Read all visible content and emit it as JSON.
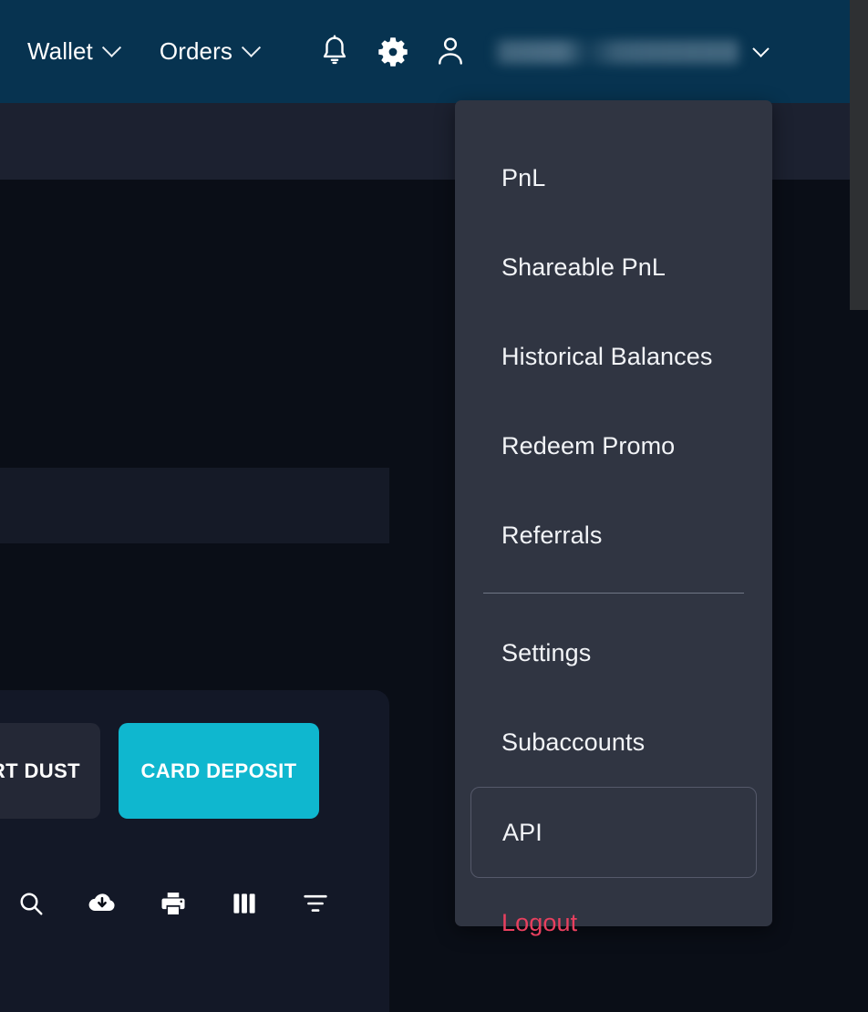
{
  "topbar": {
    "background_color": "#073350",
    "nav_items": [
      {
        "label": "Wallet",
        "icon": "chevron-down-icon"
      },
      {
        "label": "Orders",
        "icon": "chevron-down-icon"
      }
    ],
    "icons": [
      {
        "name": "notifications-bell-icon"
      },
      {
        "name": "settings-gear-icon"
      },
      {
        "name": "account-person-icon"
      }
    ],
    "user": {
      "display_name": "",
      "redacted": "blurred",
      "chevron": "chevron-down-icon"
    }
  },
  "account_menu": {
    "background_color": "#303542",
    "items": [
      {
        "label": "PnL",
        "state": "normal"
      },
      {
        "label": "Shareable PnL",
        "state": "normal"
      },
      {
        "label": "Historical Balances",
        "state": "normal"
      },
      {
        "label": "Redeem Promo",
        "state": "normal"
      },
      {
        "label": "Referrals",
        "state": "normal"
      },
      {
        "label": "Settings",
        "state": "normal"
      },
      {
        "label": "Subaccounts",
        "state": "normal"
      },
      {
        "label": "API",
        "state": "highlighted"
      },
      {
        "label": "Logout",
        "state": "danger"
      }
    ],
    "danger_color": "#e8405f",
    "divider_after": "Referrals"
  },
  "actions": {
    "convert_dust_label": "RT DUST",
    "card_deposit_label": "CARD DEPOSIT",
    "card_deposit_color": "#0fb7cf"
  },
  "table_toolbar": {
    "tools": [
      {
        "name": "search-icon"
      },
      {
        "name": "cloud-download-icon"
      },
      {
        "name": "print-icon"
      },
      {
        "name": "columns-icon"
      },
      {
        "name": "filter-icon"
      }
    ]
  },
  "scrollbar": {
    "thumb_color": "#2e3033",
    "track_color": "#0a0e17"
  }
}
